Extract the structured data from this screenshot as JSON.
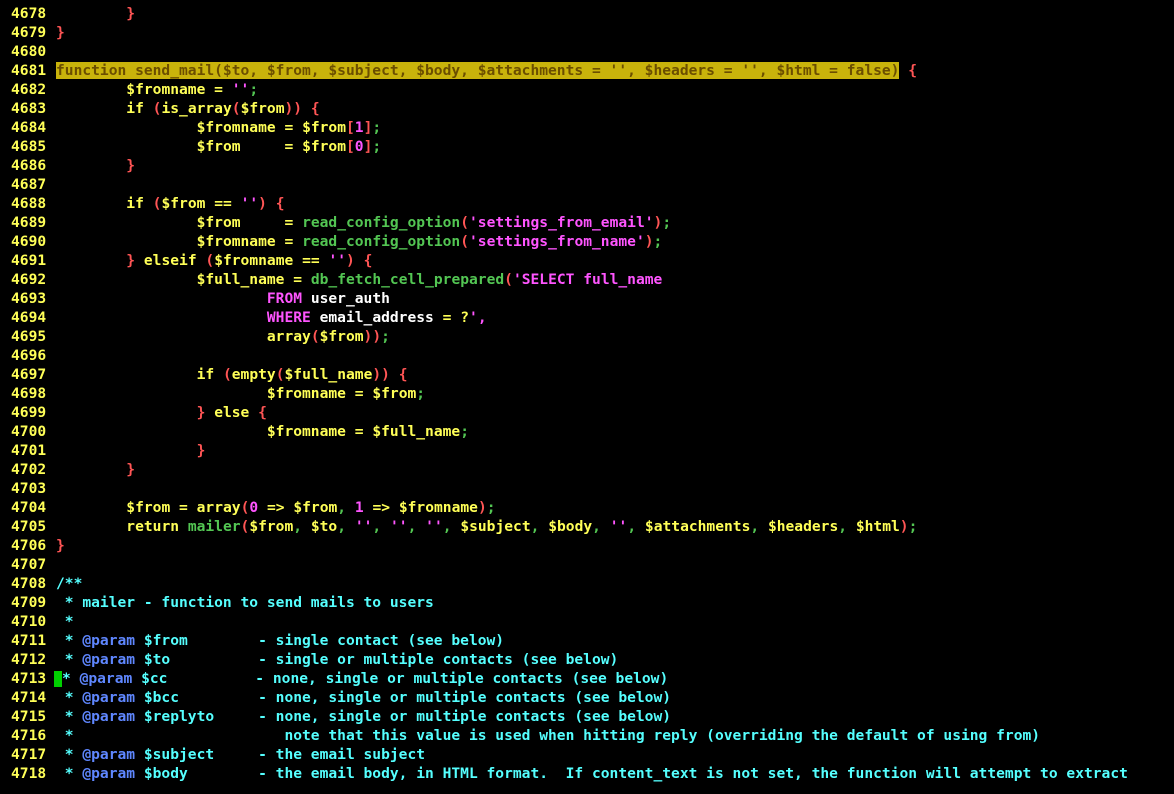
{
  "editor": {
    "highlighted_line": "4681",
    "cursor_line": "4713",
    "lines": [
      {
        "n": "4678",
        "t": "        }"
      },
      {
        "n": "4679",
        "t": "}"
      },
      {
        "n": "4680",
        "t": ""
      },
      {
        "n": "4681",
        "t": "function send_mail($to, $from, $subject, $body, $attachments = '', $headers = '', $html = false) {"
      },
      {
        "n": "4682",
        "t": "        $fromname = '';"
      },
      {
        "n": "4683",
        "t": "        if (is_array($from)) {"
      },
      {
        "n": "4684",
        "t": "                $fromname = $from[1];"
      },
      {
        "n": "4685",
        "t": "                $from     = $from[0];"
      },
      {
        "n": "4686",
        "t": "        }"
      },
      {
        "n": "4687",
        "t": ""
      },
      {
        "n": "4688",
        "t": "        if ($from == '') {"
      },
      {
        "n": "4689",
        "t": "                $from     = read_config_option('settings_from_email');"
      },
      {
        "n": "4690",
        "t": "                $fromname = read_config_option('settings_from_name');"
      },
      {
        "n": "4691",
        "t": "        } elseif ($fromname == '') {"
      },
      {
        "n": "4692",
        "t": "                $full_name = db_fetch_cell_prepared('SELECT full_name"
      },
      {
        "n": "4693",
        "t": "                        FROM user_auth"
      },
      {
        "n": "4694",
        "t": "                        WHERE email_address = ?',"
      },
      {
        "n": "4695",
        "t": "                        array($from));"
      },
      {
        "n": "4696",
        "t": ""
      },
      {
        "n": "4697",
        "t": "                if (empty($full_name)) {"
      },
      {
        "n": "4698",
        "t": "                        $fromname = $from;"
      },
      {
        "n": "4699",
        "t": "                } else {"
      },
      {
        "n": "4700",
        "t": "                        $fromname = $full_name;"
      },
      {
        "n": "4701",
        "t": "                }"
      },
      {
        "n": "4702",
        "t": "        }"
      },
      {
        "n": "4703",
        "t": ""
      },
      {
        "n": "4704",
        "t": "        $from = array(0 => $from, 1 => $fromname);"
      },
      {
        "n": "4705",
        "t": "        return mailer($from, $to, '', '', '', $subject, $body, '', $attachments, $headers, $html);"
      },
      {
        "n": "4706",
        "t": "}"
      },
      {
        "n": "4707",
        "t": ""
      },
      {
        "n": "4708",
        "t": "/**"
      },
      {
        "n": "4709",
        "t": " * mailer - function to send mails to users"
      },
      {
        "n": "4710",
        "t": " *"
      },
      {
        "n": "4711",
        "t": " * @param $from        - single contact (see below)"
      },
      {
        "n": "4712",
        "t": " * @param $to          - single or multiple contacts (see below)"
      },
      {
        "n": "4713",
        "t": " * @param $cc          - none, single or multiple contacts (see below)"
      },
      {
        "n": "4714",
        "t": " * @param $bcc         - none, single or multiple contacts (see below)"
      },
      {
        "n": "4715",
        "t": " * @param $replyto     - none, single or multiple contacts (see below)"
      },
      {
        "n": "4716",
        "t": " *                        note that this value is used when hitting reply (overriding the default of using from)"
      },
      {
        "n": "4717",
        "t": " * @param $subject     - the email subject"
      },
      {
        "n": "4718",
        "t": " * @param $body        - the email body, in HTML format.  If content_text is not set, the function will attempt to extract"
      }
    ]
  }
}
